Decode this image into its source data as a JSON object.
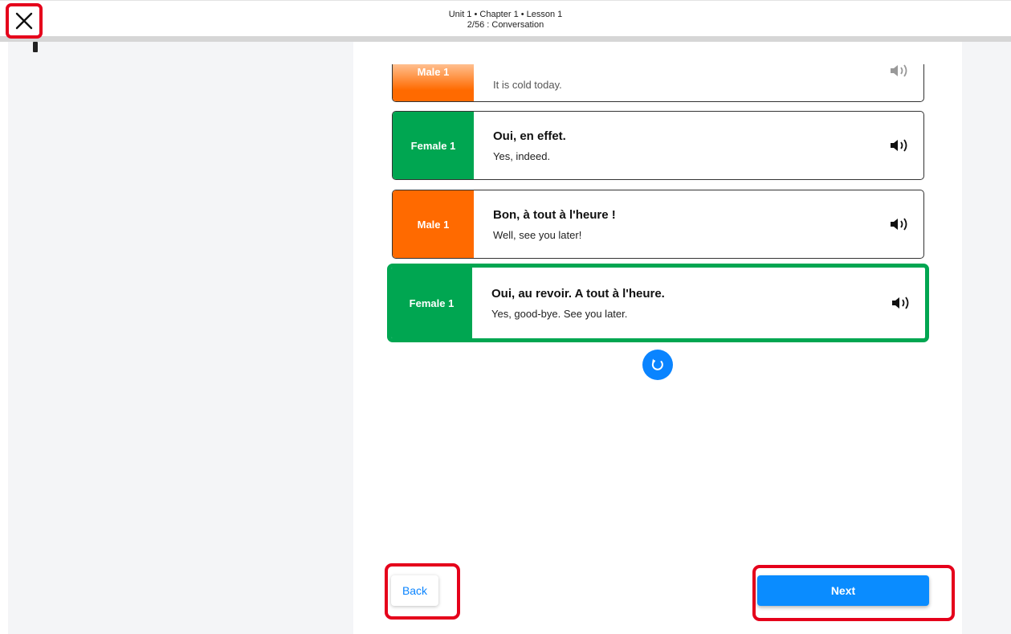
{
  "header": {
    "breadcrumb": "Unit 1 • Chapter 1 • Lesson 1",
    "subtitle": "2/56 : Conversation"
  },
  "icons": {
    "close": "close-icon",
    "audio": "speaker-icon",
    "replay": "replay-icon"
  },
  "colors": {
    "male": "#ff6a00",
    "female": "#00a651",
    "accent": "#0a84ff",
    "highlight": "#e5001b"
  },
  "dialogue": [
    {
      "speaker": "Male 1",
      "french": "",
      "english": "It is cold today.",
      "state": "partially-scrolled"
    },
    {
      "speaker": "Female 1",
      "french": "Oui, en effet.",
      "english": "Yes, indeed.",
      "state": "normal"
    },
    {
      "speaker": "Male 1",
      "french": "Bon, à tout à l'heure !",
      "english": "Well, see you later!",
      "state": "normal"
    },
    {
      "speaker": "Female 1",
      "french": "Oui, au revoir. A tout à l'heure.",
      "english": "Yes, good-bye. See you later.",
      "state": "active"
    }
  ],
  "footer": {
    "back_label": "Back",
    "next_label": "Next"
  }
}
